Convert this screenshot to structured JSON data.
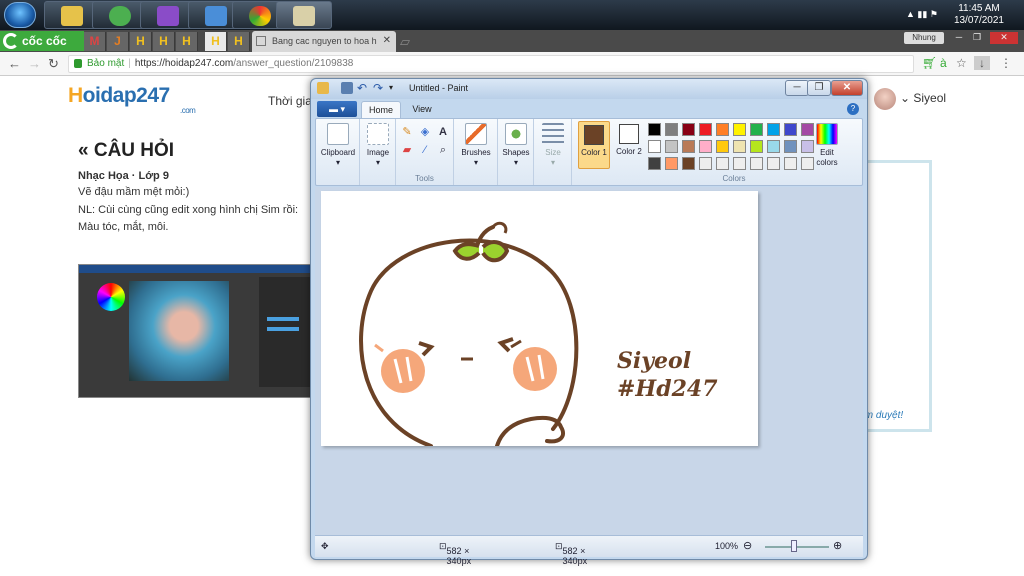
{
  "taskbar": {
    "time": "11:45 AM",
    "date": "13/07/2021"
  },
  "browser": {
    "brand": "cốc cốc",
    "pinned_tabs": [
      "M",
      "J",
      "H",
      "H",
      "H",
      "H",
      "H"
    ],
    "active_tab": "Bang cac nguyen to hoa h",
    "profile": "Nhung",
    "secure_label": "Bảo mật",
    "url_base": "https://hoidap247.com",
    "url_path": "/answer_question/2109838"
  },
  "site": {
    "logo_main": "oidap247",
    "logo_h": "H",
    "logo_com": ".com",
    "nav_partial": "Thời gia",
    "username": "Siyeol",
    "section_title": "CÂU HỎI",
    "meta": "Nhạc Họa · Lớp 9",
    "question_lines": [
      "Vẽ đậu mầm mệt mỏi:)",
      "NL: Cùi cùng cũng edit xong hình chị Sim rồi:",
      "Màu tóc, mắt, môi."
    ],
    "pending_note": "kiểm duyệt!"
  },
  "paint": {
    "title": "Untitled - Paint",
    "tabs": [
      "Home",
      "View"
    ],
    "groups": {
      "clipboard": "Clipboard",
      "image": "Image",
      "tools": "Tools",
      "brushes": "Brushes",
      "shapes": "Shapes",
      "size": "Size",
      "color1": "Color 1",
      "color2": "Color 2",
      "colors": "Colors",
      "edit_colors": "Edit colors"
    },
    "palette": [
      "#000000",
      "#7f7f7f",
      "#880015",
      "#ed1c24",
      "#ff7f27",
      "#fff200",
      "#22b14c",
      "#00a2e8",
      "#3f48cc",
      "#a349a4",
      "#ffffff",
      "#c3c3c3",
      "#b97a57",
      "#ffaec9",
      "#ffc90e",
      "#efe4b0",
      "#b5e61d",
      "#99d9ea",
      "#7092be",
      "#c8bfe7",
      "#404040",
      "#ff9966",
      "#6b4226",
      "#eeeeee",
      "#eeeeee",
      "#eeeeee",
      "#eeeeee",
      "#eeeeee",
      "#eeeeee",
      "#eeeeee"
    ],
    "color1": "#6b4226",
    "color2": "#ffffff",
    "status": {
      "selection_size": "582 × 340px",
      "image_size": "582 × 340px",
      "zoom": "100%"
    },
    "drawing_text": [
      "Siyeol",
      "#Hd247"
    ]
  }
}
